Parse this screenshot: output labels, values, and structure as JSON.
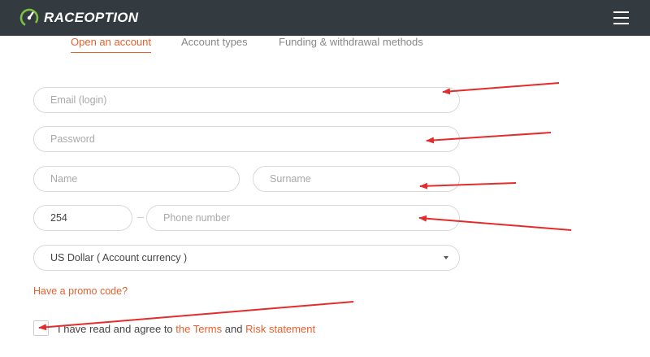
{
  "header": {
    "brand": "RACEOPTION",
    "logo_icon": "speedometer-logo-icon",
    "menu_icon": "hamburger-menu-icon",
    "bg_color": "#333a40"
  },
  "tabs": [
    {
      "label": "Open an account",
      "active": true
    },
    {
      "label": "Account types",
      "active": false
    },
    {
      "label": "Funding & withdrawal methods",
      "active": false
    }
  ],
  "form": {
    "email_placeholder": "Email (login)",
    "password_placeholder": "Password",
    "name_placeholder": "Name",
    "surname_placeholder": "Surname",
    "phone_code": "254",
    "phone_placeholder": "Phone number",
    "currency_selected": "US Dollar ( Account currency )",
    "promo_link": "Have a promo code?",
    "agree_text": "I have read and agree to",
    "terms_link": "the Terms",
    "and_text": "and",
    "risk_link": "Risk statement"
  },
  "colors": {
    "accent": "#e8602d",
    "annotation_arrow": "#e32c2c"
  }
}
